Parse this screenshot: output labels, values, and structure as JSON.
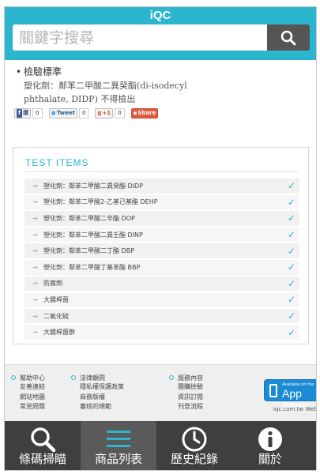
{
  "header": {
    "app_title": "iQC",
    "search_placeholder": "關鍵字搜尋",
    "search_icon": "search-icon"
  },
  "standard": {
    "heading": "檢驗標準",
    "body": "塑化劑：鄰苯二甲酸二異癸酯(di-isodecyl phthalate, DIDP) 不得檢出"
  },
  "share": {
    "facebook_label": "讚",
    "facebook_count": "0",
    "twitter_label": "Tweet",
    "twitter_count": "0",
    "gplus_label": "+1",
    "gplus_count": "0",
    "share_label": "Share"
  },
  "test_items": {
    "title": "TEST ITEMS",
    "items": [
      {
        "label": "塑化劑：鄰苯二甲酸二異癸酯 DIDP"
      },
      {
        "label": "塑化劑：鄰苯二甲酸2-乙基己基酯 DEHP"
      },
      {
        "label": "塑化劑：鄰苯二甲酸二辛酯 DOP"
      },
      {
        "label": "塑化劑：鄰苯二甲酸二異壬酯 DINP"
      },
      {
        "label": "塑化劑：鄰苯二甲酸二丁酯 DBP"
      },
      {
        "label": "塑化劑：鄰苯二甲酸丁基苯酯 BBP"
      },
      {
        "label": "防腐劑"
      },
      {
        "label": "大腸桿菌"
      },
      {
        "label": "二氧化硫"
      },
      {
        "label": "大腸桿菌群"
      }
    ],
    "check_glyph": "✓",
    "arrow_glyph": "→"
  },
  "footer": {
    "col1": {
      "head": "幫助中心",
      "items": [
        "友善連結",
        "網站地圖",
        "常見問題"
      ]
    },
    "col2": {
      "head": "法律顧問",
      "items": [
        "隱私權保護政策",
        "商務版權",
        "審核的規範"
      ]
    },
    "col3": {
      "head": "服務內容",
      "items": [
        "團購檢驗",
        "資訊訂閱",
        "刊登流程"
      ]
    },
    "appstore_small": "Available on the",
    "appstore_big": "App Store",
    "web_note": "iqc.com.tw Web"
  },
  "tabbar": {
    "tabs": [
      {
        "label": "條碼掃瞄",
        "icon": "search-icon"
      },
      {
        "label": "商品列表",
        "icon": "list-icon"
      },
      {
        "label": "歷史紀錄",
        "icon": "clock-icon"
      },
      {
        "label": "關於",
        "icon": "info-icon"
      }
    ],
    "active_index": 1
  },
  "colors": {
    "accent": "#2bb5cf",
    "tabbar": "#3f3f3f",
    "tab_active": "#5a5a5a"
  }
}
